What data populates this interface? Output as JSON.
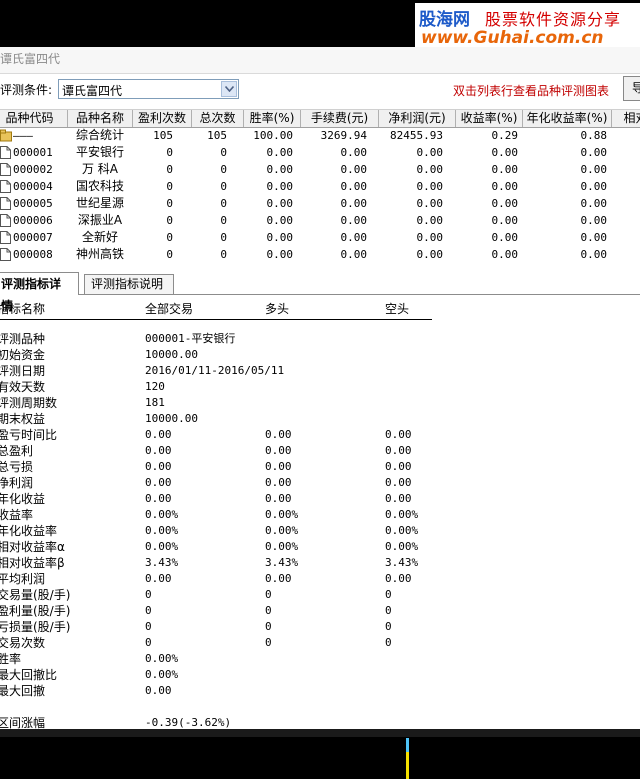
{
  "watermark": {
    "brand": "股海网",
    "slogan": "股票软件资源分享",
    "url": "www.Guhai.com.cn"
  },
  "window": {
    "title": "谭氏富四代"
  },
  "condition": {
    "label": "评测条件:",
    "value": "谭氏富四代"
  },
  "hint": "双击列表行查看品种评测图表",
  "export_label": "导",
  "table": {
    "headers": [
      "品种代码",
      "品种名称",
      "盈利次数",
      "总次数",
      "胜率(%)",
      "手续费(元)",
      "净利润(元)",
      "收益率(%)",
      "年化收益率(%)",
      "相对"
    ],
    "rows": [
      {
        "code": "———",
        "name": "综合统计",
        "win": "105",
        "total": "105",
        "rate": "100.00",
        "fee": "3269.94",
        "profit": "82455.93",
        "ret": "0.29",
        "annual": "0.88"
      },
      {
        "code": "000001",
        "name": "平安银行",
        "win": "0",
        "total": "0",
        "rate": "0.00",
        "fee": "0.00",
        "profit": "0.00",
        "ret": "0.00",
        "annual": "0.00"
      },
      {
        "code": "000002",
        "name": "万  科A",
        "win": "0",
        "total": "0",
        "rate": "0.00",
        "fee": "0.00",
        "profit": "0.00",
        "ret": "0.00",
        "annual": "0.00"
      },
      {
        "code": "000004",
        "name": "国农科技",
        "win": "0",
        "total": "0",
        "rate": "0.00",
        "fee": "0.00",
        "profit": "0.00",
        "ret": "0.00",
        "annual": "0.00"
      },
      {
        "code": "000005",
        "name": "世纪星源",
        "win": "0",
        "total": "0",
        "rate": "0.00",
        "fee": "0.00",
        "profit": "0.00",
        "ret": "0.00",
        "annual": "0.00"
      },
      {
        "code": "000006",
        "name": "深振业A",
        "win": "0",
        "total": "0",
        "rate": "0.00",
        "fee": "0.00",
        "profit": "0.00",
        "ret": "0.00",
        "annual": "0.00"
      },
      {
        "code": "000007",
        "name": "全新好",
        "win": "0",
        "total": "0",
        "rate": "0.00",
        "fee": "0.00",
        "profit": "0.00",
        "ret": "0.00",
        "annual": "0.00"
      },
      {
        "code": "000008",
        "name": "神州高铁",
        "win": "0",
        "total": "0",
        "rate": "0.00",
        "fee": "0.00",
        "profit": "0.00",
        "ret": "0.00",
        "annual": "0.00"
      }
    ]
  },
  "tabs": {
    "detail": "评测指标详情",
    "explain": "评测指标说明"
  },
  "detail": {
    "headers": {
      "name": "指标名称",
      "all": "全部交易",
      "long": "多头",
      "short": "空头"
    },
    "rows": [
      {
        "label": "评测品种",
        "all": "000001-平安银行",
        "long": "",
        "short": ""
      },
      {
        "label": "初始资金",
        "all": "10000.00",
        "long": "",
        "short": ""
      },
      {
        "label": "评测日期",
        "all": "2016/01/11-2016/05/11",
        "long": "",
        "short": ""
      },
      {
        "label": "有效天数",
        "all": "120",
        "long": "",
        "short": ""
      },
      {
        "label": "评测周期数",
        "all": "181",
        "long": "",
        "short": ""
      },
      {
        "label": "期末权益",
        "all": "10000.00",
        "long": "",
        "short": ""
      },
      {
        "label": "盈亏时间比",
        "all": "0.00",
        "long": "0.00",
        "short": "0.00"
      },
      {
        "label": "总盈利",
        "all": "0.00",
        "long": "0.00",
        "short": "0.00"
      },
      {
        "label": "总亏损",
        "all": "0.00",
        "long": "0.00",
        "short": "0.00"
      },
      {
        "label": "净利润",
        "all": "0.00",
        "long": "0.00",
        "short": "0.00"
      },
      {
        "label": "年化收益",
        "all": "0.00",
        "long": "0.00",
        "short": "0.00"
      },
      {
        "label": "收益率",
        "all": "0.00%",
        "long": "0.00%",
        "short": "0.00%"
      },
      {
        "label": "年化收益率",
        "all": "0.00%",
        "long": "0.00%",
        "short": "0.00%"
      },
      {
        "label": "相对收益率α",
        "all": "0.00%",
        "long": "0.00%",
        "short": "0.00%"
      },
      {
        "label": "相对收益率β",
        "all": "3.43%",
        "long": "3.43%",
        "short": "3.43%"
      },
      {
        "label": "平均利润",
        "all": "0.00",
        "long": "0.00",
        "short": "0.00"
      },
      {
        "label": "交易量(股/手)",
        "all": "0",
        "long": "0",
        "short": "0"
      },
      {
        "label": "盈利量(股/手)",
        "all": "0",
        "long": "0",
        "short": "0"
      },
      {
        "label": "亏损量(股/手)",
        "all": "0",
        "long": "0",
        "short": "0"
      },
      {
        "label": "交易次数",
        "all": "0",
        "long": "0",
        "short": "0"
      },
      {
        "label": "胜率",
        "all": "0.00%",
        "long": "",
        "short": ""
      },
      {
        "label": "最大回撤比",
        "all": "0.00%",
        "long": "",
        "short": ""
      },
      {
        "label": "最大回撤",
        "all": "0.00",
        "long": "",
        "short": ""
      },
      {
        "label": "",
        "all": "",
        "long": "",
        "short": ""
      },
      {
        "label": "区间涨幅",
        "all": "-0.39(-3.62%)",
        "long": "",
        "short": ""
      }
    ]
  },
  "colors": {
    "hint": "#C00000",
    "brand": "#1E5BC9",
    "slogan": "#D40000",
    "url": "#E8660A"
  }
}
